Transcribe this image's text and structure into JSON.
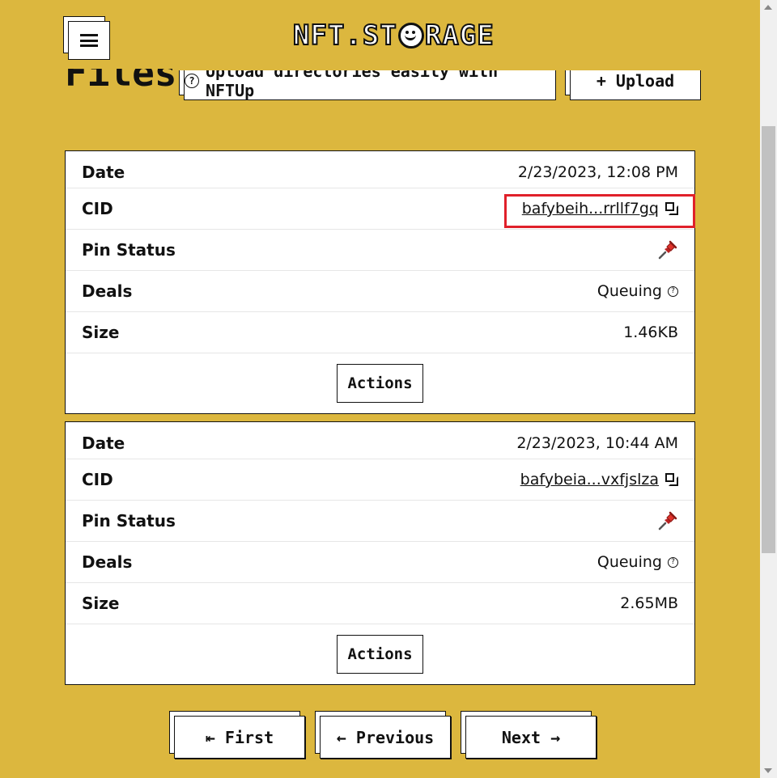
{
  "header": {
    "logo": [
      "NFT.ST",
      "RAGE"
    ],
    "menu_icon": "hamburger-icon"
  },
  "page": {
    "title": "Files",
    "nftup_button": {
      "icon": "question-circle-icon",
      "icon_glyph": "?",
      "label": "Upload directories easily with NFTUp"
    },
    "upload_button": {
      "label": "+ Upload"
    }
  },
  "files": [
    {
      "date_label": "Date",
      "date": "2/23/2023, 12:08 PM",
      "cid_label": "CID",
      "cid": "bafybeih...rrllf7gq",
      "pin_label": "Pin Status",
      "pin_icon": "pushpin-icon",
      "deals_label": "Deals",
      "deals": "Queuing",
      "size_label": "Size",
      "size": "1.46KB",
      "actions_label": "Actions"
    },
    {
      "date_label": "Date",
      "date": "2/23/2023, 10:44 AM",
      "cid_label": "CID",
      "cid": "bafybeia...vxfjslza",
      "pin_label": "Pin Status",
      "pin_icon": "pushpin-icon",
      "deals_label": "Deals",
      "deals": "Queuing",
      "size_label": "Size",
      "size": "2.65MB",
      "actions_label": "Actions"
    }
  ],
  "pagination": {
    "first": "⇤ First",
    "previous": "← Previous",
    "next": "Next →"
  },
  "colors": {
    "background": "#dcb73e",
    "highlight": "#e0202a",
    "pin": "#e0322b"
  }
}
